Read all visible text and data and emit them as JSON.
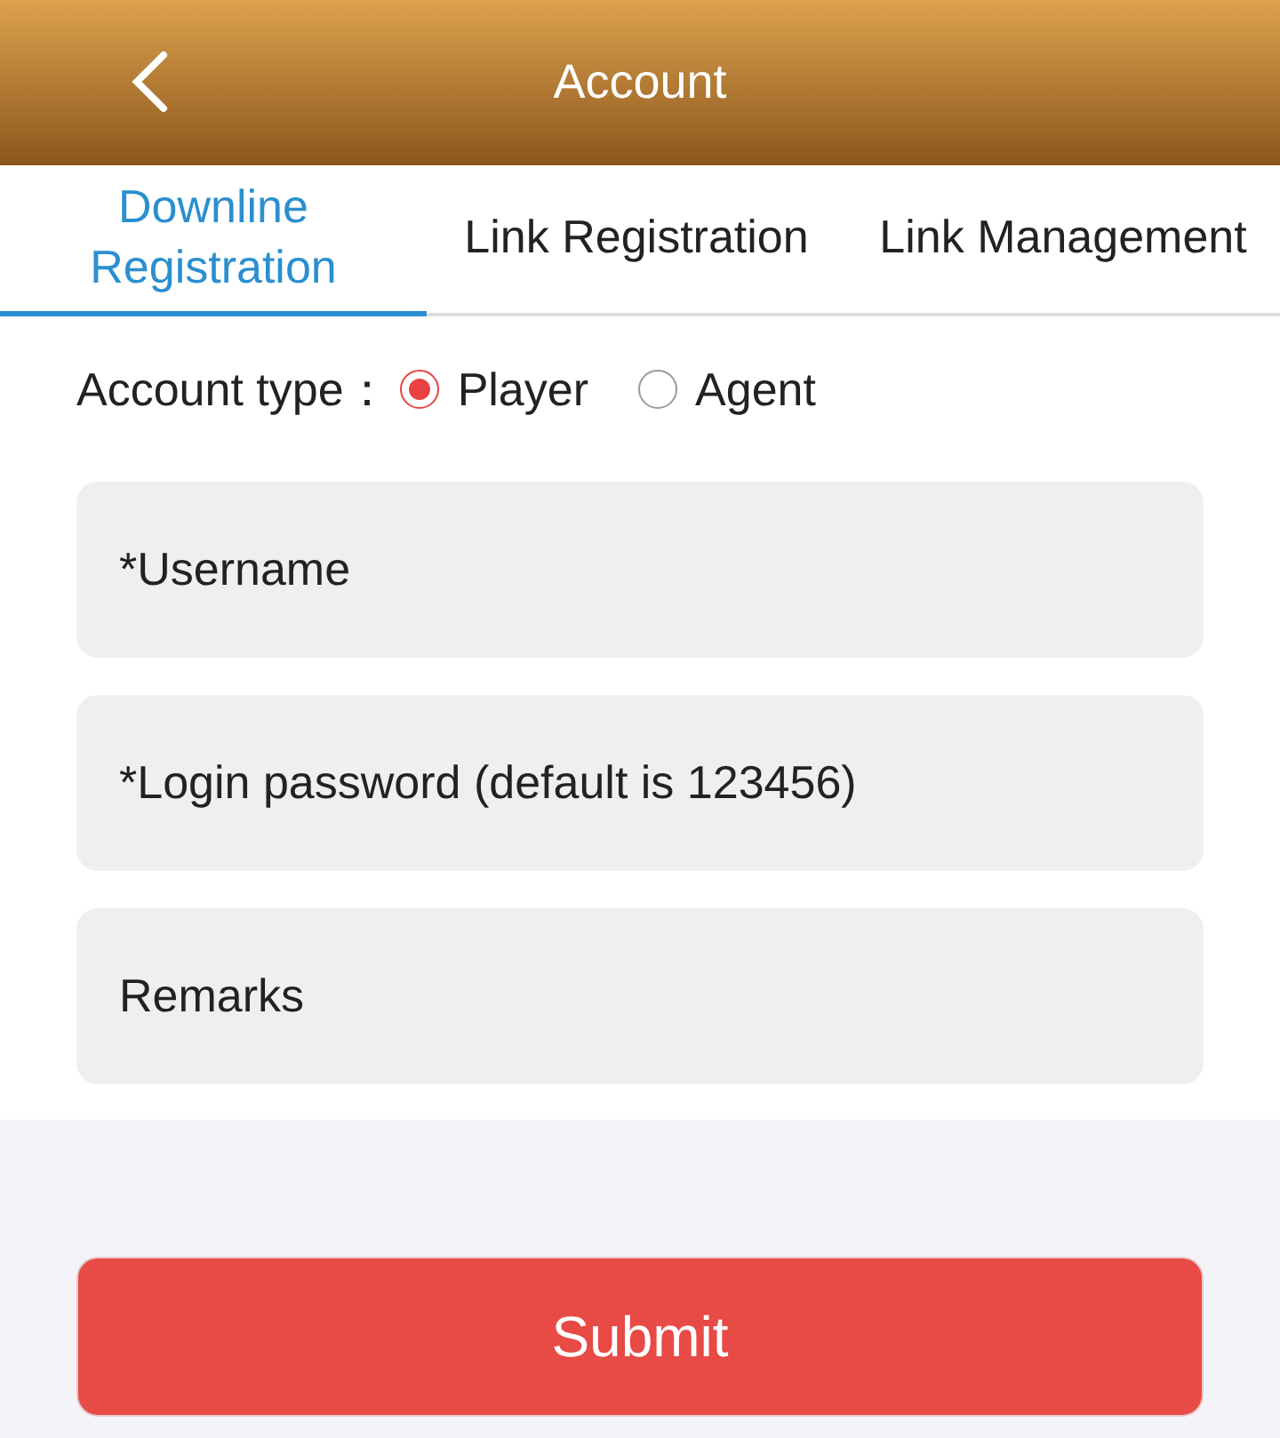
{
  "header": {
    "title": "Account"
  },
  "tabs": [
    {
      "label": "Downline Registration",
      "selected": true
    },
    {
      "label": "Link Registration",
      "selected": false
    },
    {
      "label": "Link Management",
      "selected": false
    }
  ],
  "account_type": {
    "label": "Account type：",
    "options": [
      {
        "label": "Player",
        "selected": true
      },
      {
        "label": "Agent",
        "selected": false
      }
    ]
  },
  "fields": [
    {
      "placeholder": "*Username"
    },
    {
      "placeholder": "*Login password (default is 123456)"
    },
    {
      "placeholder": "Remarks"
    }
  ],
  "submit_button": "Submit"
}
